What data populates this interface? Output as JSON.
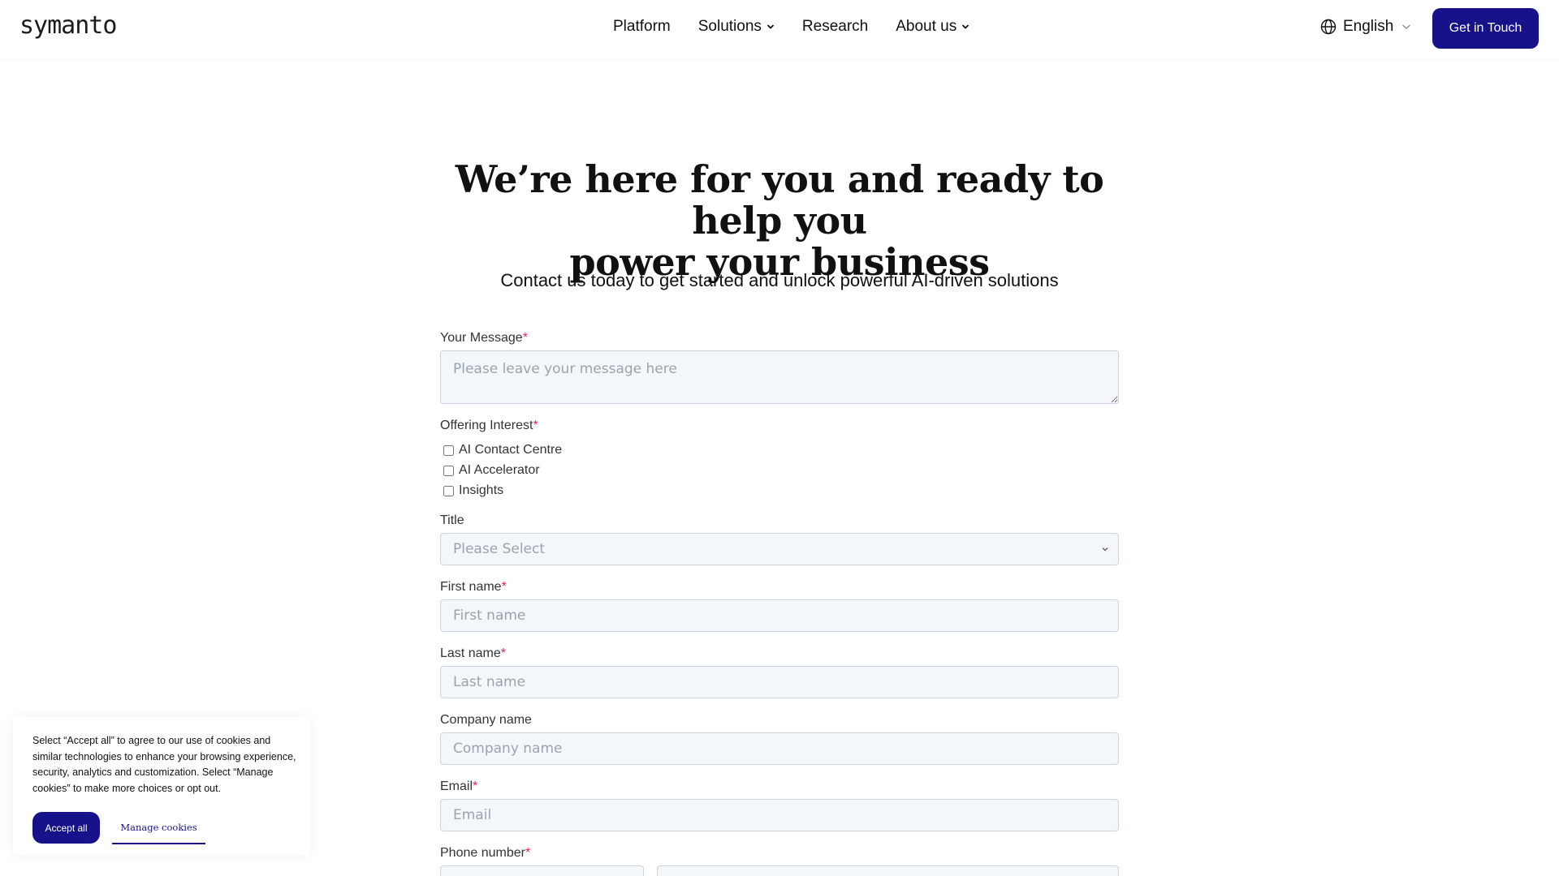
{
  "brand": {
    "logo": "symanto",
    "accent": "#17128a"
  },
  "nav": {
    "items": [
      {
        "label": "Platform",
        "has_dropdown": false
      },
      {
        "label": "Solutions",
        "has_dropdown": true
      },
      {
        "label": "Research",
        "has_dropdown": false
      },
      {
        "label": "About us",
        "has_dropdown": true
      }
    ],
    "language": "English",
    "cta": "Get in Touch"
  },
  "hero": {
    "title_line1": "We’re here for you and ready to help you",
    "title_line2": "power your business",
    "subtitle": "Contact us today to get started and unlock powerful AI-driven solutions"
  },
  "form": {
    "message": {
      "label": "Your Message",
      "required": "*",
      "placeholder": "Please leave your message here",
      "value": ""
    },
    "offering": {
      "label": "Offering Interest",
      "required": "*",
      "options": [
        {
          "label": "AI Contact Centre",
          "checked": false
        },
        {
          "label": "AI Accelerator",
          "checked": false
        },
        {
          "label": "Insights",
          "checked": false
        }
      ]
    },
    "title": {
      "label": "Title",
      "selected": "Please Select"
    },
    "first_name": {
      "label": "First name",
      "required": "*",
      "placeholder": "First name",
      "value": ""
    },
    "last_name": {
      "label": "Last name",
      "required": "*",
      "placeholder": "Last name",
      "value": ""
    },
    "company": {
      "label": "Company name",
      "placeholder": "Company name",
      "value": ""
    },
    "email": {
      "label": "Email",
      "required": "*",
      "placeholder": "Email",
      "value": ""
    },
    "phone": {
      "label": "Phone number",
      "required": "*"
    }
  },
  "cookie": {
    "text": "Select “Accept all” to agree to our use of cookies and similar technologies to enhance your browsing experience, security, analytics and customization. Select “Manage cookies” to make more choices or opt out.",
    "accept": "Accept all",
    "manage": "Manage cookies"
  },
  "icons": {
    "language": "globe-icon",
    "dropdown": "chevron-down-icon"
  }
}
